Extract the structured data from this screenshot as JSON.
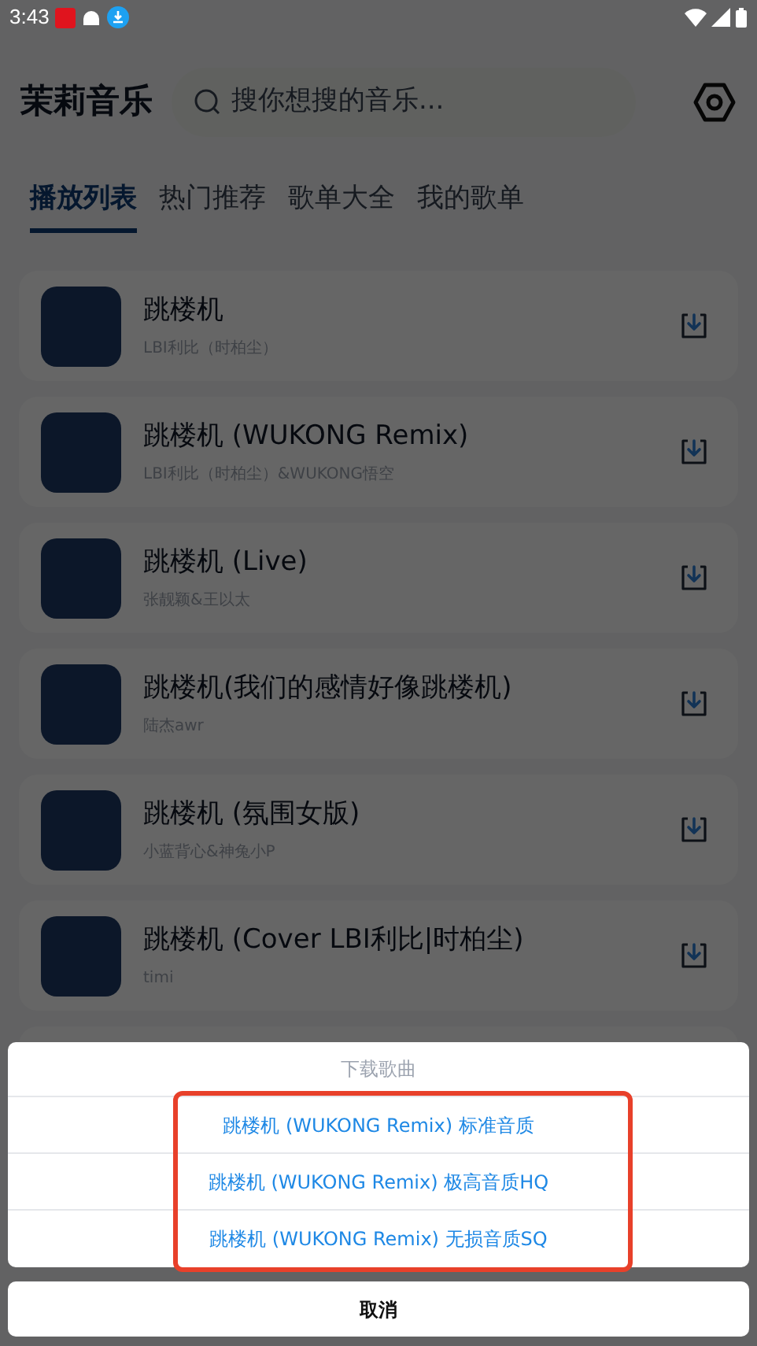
{
  "status_bar": {
    "time": "3:43"
  },
  "header": {
    "title": "茉莉音乐",
    "search": {
      "placeholder": "搜你想搜的音乐..."
    }
  },
  "tabs": [
    {
      "label": "播放列表",
      "selected": true
    },
    {
      "label": "热门推荐",
      "selected": false
    },
    {
      "label": "歌单大全",
      "selected": false
    },
    {
      "label": "我的歌单",
      "selected": false
    }
  ],
  "songs": [
    {
      "title": "跳楼机",
      "artist": "LBI利比（时柏尘）"
    },
    {
      "title": "跳楼机 (WUKONG Remix)",
      "artist": "LBI利比（时柏尘）&WUKONG悟空"
    },
    {
      "title": "跳楼机 (Live)",
      "artist": "张靓颖&王以太"
    },
    {
      "title": "跳楼机(我们的感情好像跳楼机)",
      "artist": "陆杰awr"
    },
    {
      "title": "跳楼机 (氛围女版)",
      "artist": "小蓝背心&神兔小P"
    },
    {
      "title": "跳楼机 (Cover LBI利比|时柏尘)",
      "artist": "timi"
    }
  ],
  "download_sheet": {
    "title": "下载歌曲",
    "options": [
      "跳楼机 (WUKONG Remix) 标准音质",
      "跳楼机 (WUKONG Remix) 极高音质HQ",
      "跳楼机 (WUKONG Remix) 无损音质SQ"
    ],
    "cancel": "取消"
  }
}
